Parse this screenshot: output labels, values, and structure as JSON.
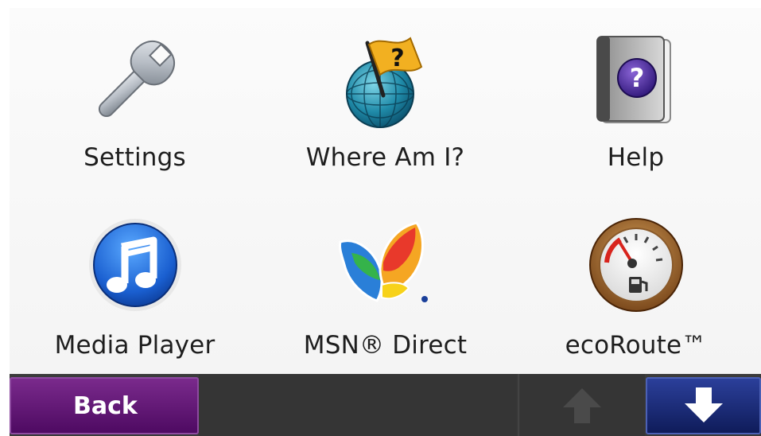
{
  "menu": {
    "items": [
      {
        "label": "Settings",
        "icon": "wrench-icon"
      },
      {
        "label": "Where Am I?",
        "icon": "globe-flag-question-icon"
      },
      {
        "label": "Help",
        "icon": "help-book-icon"
      },
      {
        "label": "Media Player",
        "icon": "music-note-icon"
      },
      {
        "label": "MSN® Direct",
        "icon": "msn-butterfly-icon"
      },
      {
        "label": "ecoRoute™",
        "icon": "fuel-gauge-icon"
      }
    ]
  },
  "nav": {
    "back_label": "Back",
    "up_icon": "arrow-up-icon",
    "down_icon": "arrow-down-icon"
  },
  "colors": {
    "back_button": "#5e1473",
    "down_button": "#1a2b7a",
    "bar": "#3b3b3b"
  }
}
